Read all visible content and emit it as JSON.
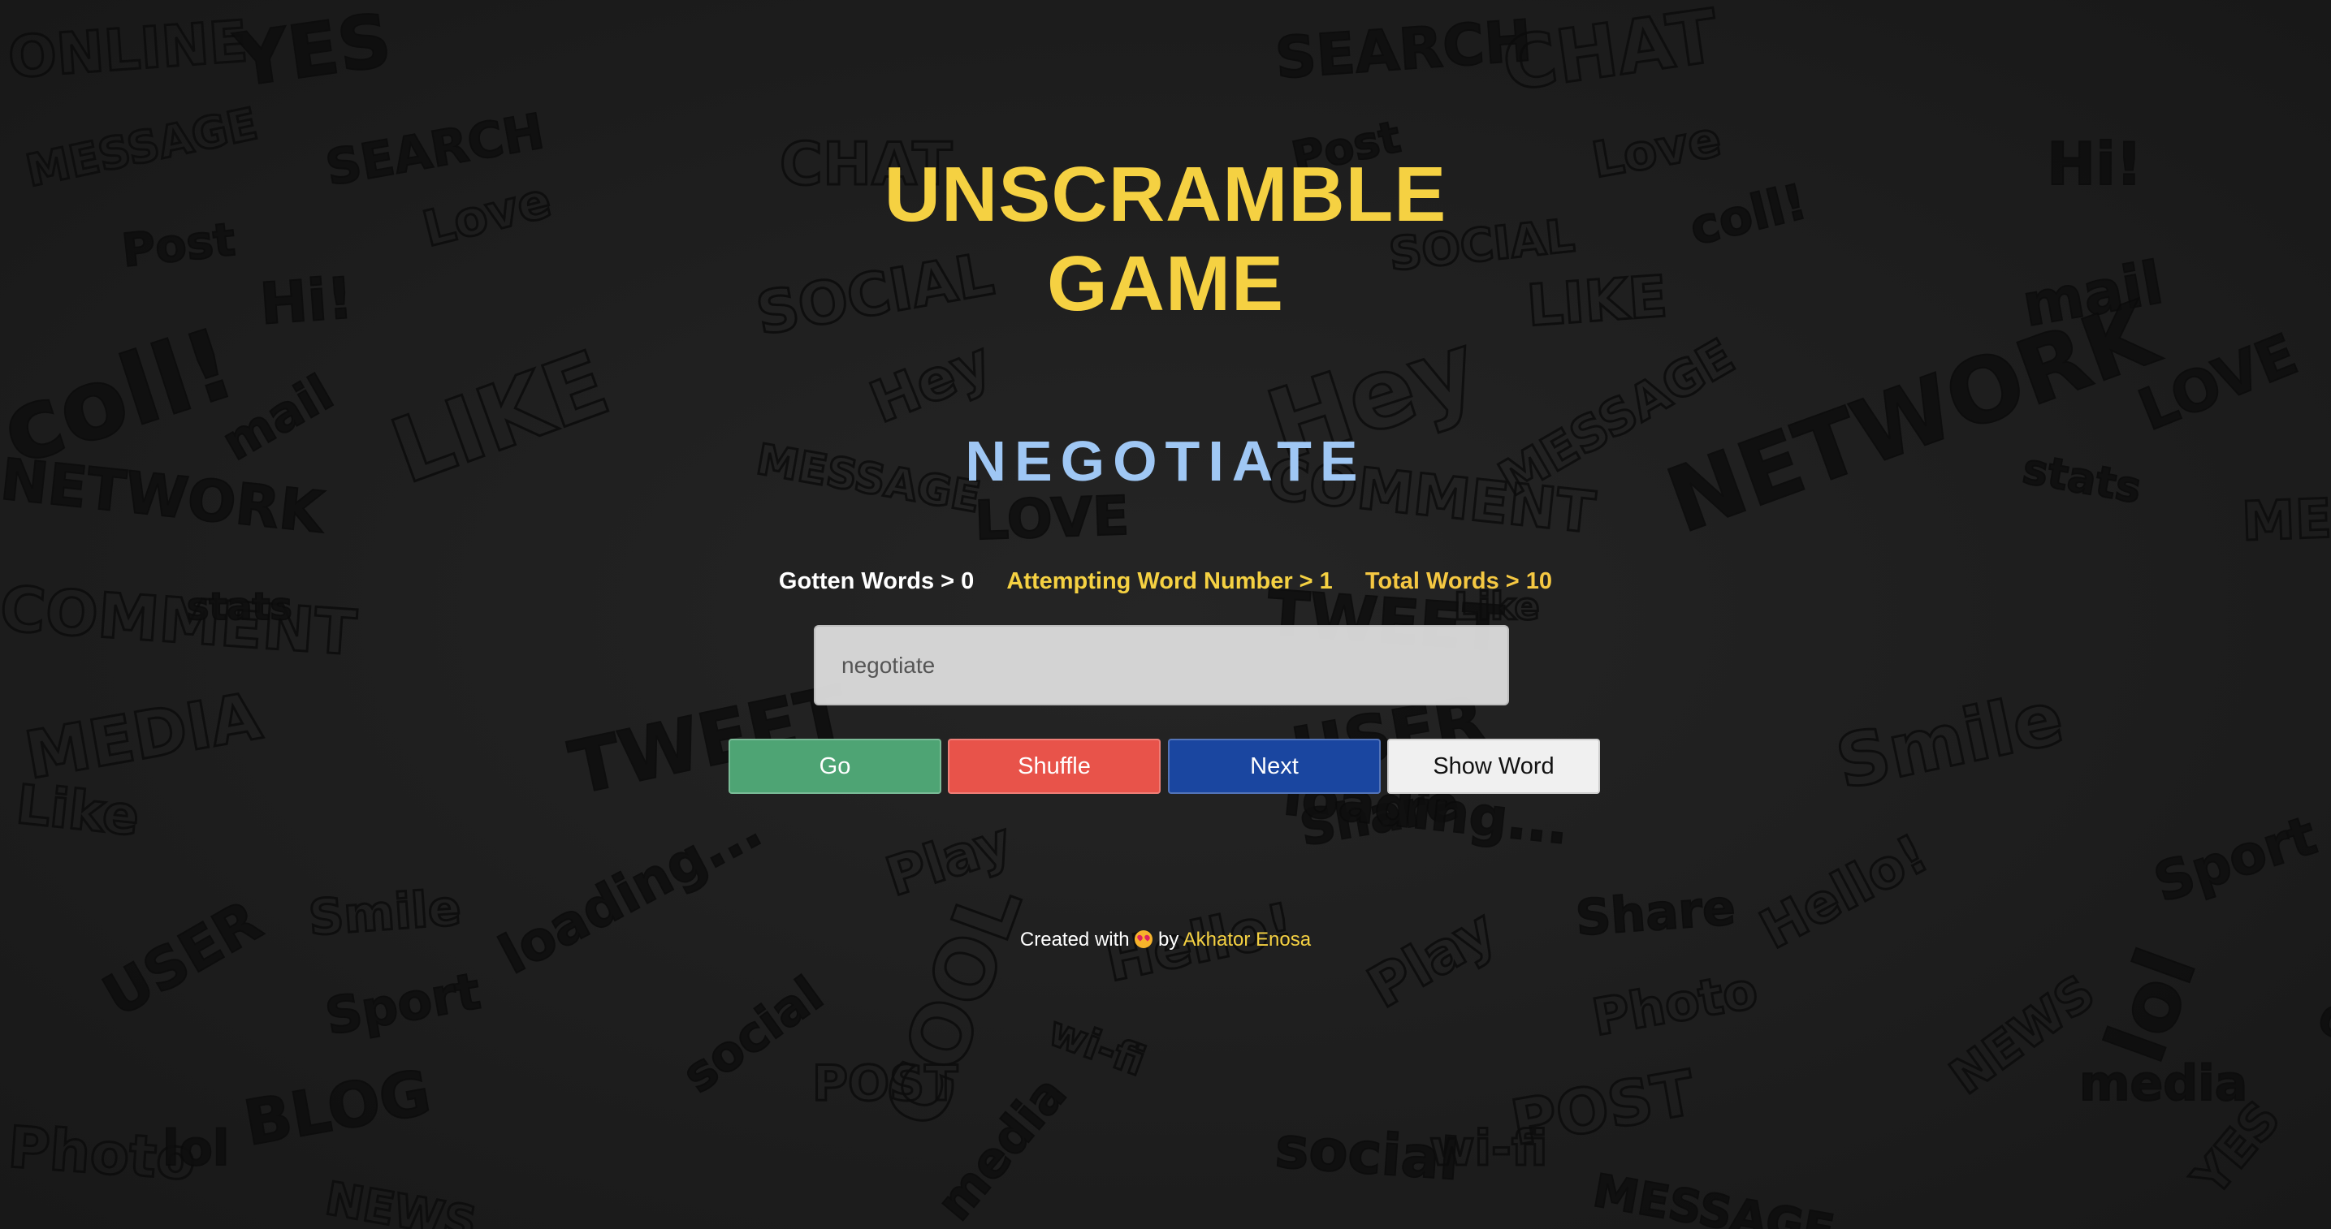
{
  "game": {
    "title_line1": "UNSCRAMBLE",
    "title_line2": "GAME",
    "scrambled_word": "NEGOTIATE"
  },
  "stats": {
    "gotten": "Gotten Words > 0",
    "attempting": "Attempting Word Number > 1",
    "total": "Total Words > 10"
  },
  "input": {
    "placeholder": "negotiate",
    "value": ""
  },
  "buttons": {
    "go": "Go",
    "shuffle": "Shuffle",
    "next": "Next",
    "show_word": "Show Word"
  },
  "footer": {
    "prefix": "Created with",
    "emoji": "heart-eyes-emoji-icon",
    "by": "by",
    "author": "Akhator Enosa"
  },
  "background": {
    "doodle_words": [
      "ONLINE",
      "YES",
      "MESSAGE",
      "SEARCH",
      "CHAT",
      "Post",
      "Love",
      "Hi!",
      "SOCIAL",
      "coll!",
      "LIKE",
      "mail",
      "Hey",
      "NETWORK",
      "MESSAGE",
      "LOVE",
      "COMMENT",
      "stats",
      "MEDIA",
      "TWEET",
      "Like",
      "USER",
      "Smile",
      "loading...",
      "Play",
      "Share",
      "Hello!",
      "Sport",
      "COOL",
      "BLOG",
      "Photo",
      "lol",
      "POST",
      "social",
      "wi-fi",
      "media",
      "NEWS"
    ]
  },
  "colors": {
    "title": "#f5d142",
    "scrambled": "#9fc7f4",
    "go": "#4ea474",
    "shuffle": "#e8534a",
    "next": "#1a46a0",
    "show_word": "#f0f0f0",
    "background": "#1f1f1f"
  }
}
